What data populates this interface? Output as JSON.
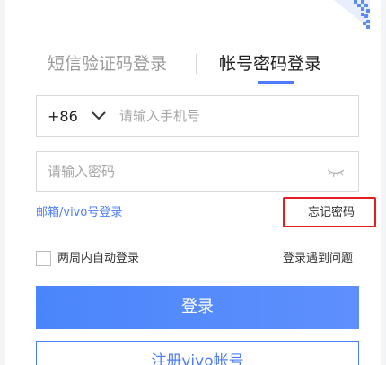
{
  "tabs": {
    "sms_login": "短信验证码登录",
    "account_login": "帐号密码登录",
    "active": "account_login"
  },
  "phone": {
    "country_code": "+86",
    "value": "",
    "placeholder": "请输入手机号"
  },
  "password": {
    "value": "",
    "placeholder": "请输入密码"
  },
  "links": {
    "email_vivo_login": "邮箱/vivo号登录",
    "forgot_password": "忘记密码",
    "login_problem": "登录遇到问题"
  },
  "auto_login": {
    "label": "两周内自动登录",
    "checked": false
  },
  "buttons": {
    "login": "登录",
    "register": "注册vivo帐号"
  },
  "colors": {
    "accent": "#4d7cfe",
    "highlight_box": "#e02020"
  },
  "icons": {
    "qr": "qr-code-icon",
    "chevron": "chevron-down-icon",
    "eye": "eye-closed-icon"
  }
}
